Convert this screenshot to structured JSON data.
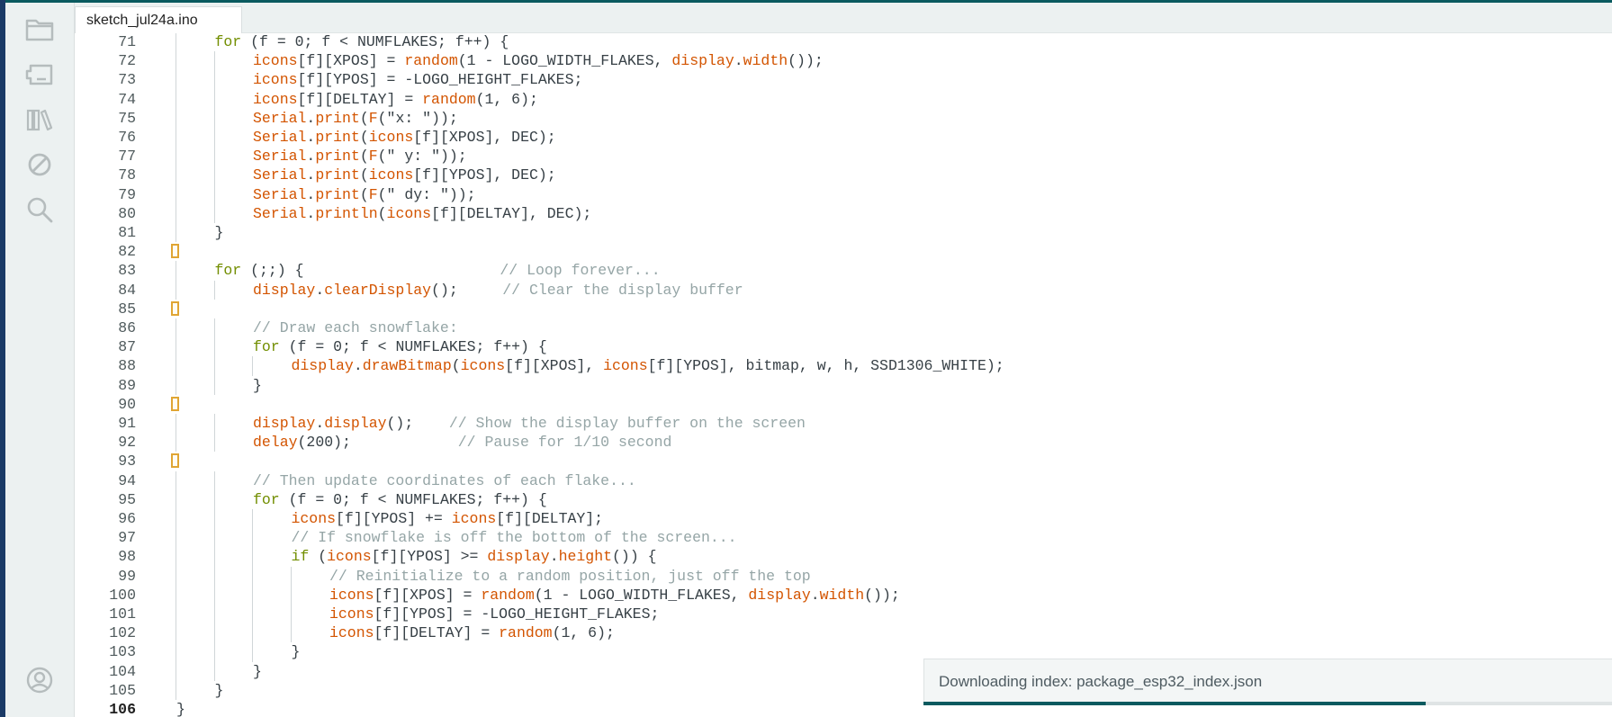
{
  "window": {
    "accent_color": "#0a5a5f"
  },
  "sidebar": {
    "items": [
      {
        "icon": "folder-icon",
        "label": "Sketchbook"
      },
      {
        "icon": "board-icon",
        "label": "Boards Manager"
      },
      {
        "icon": "library-icon",
        "label": "Library Manager"
      },
      {
        "icon": "debug-icon",
        "label": "Debug"
      },
      {
        "icon": "search-icon",
        "label": "Search"
      }
    ],
    "profile_icon": "profile-icon"
  },
  "tabs": [
    {
      "label": "sketch_jul24a.ino",
      "active": true
    }
  ],
  "editor": {
    "current_line": 106,
    "lines": [
      {
        "num": 71,
        "indent": 2,
        "tokens": [
          {
            "t": "for",
            "c": "keyword"
          },
          {
            "t": " (f = 0; f < NUMFLAKES; f++) {",
            "c": "plain"
          }
        ]
      },
      {
        "num": 72,
        "indent": 3,
        "tokens": [
          {
            "t": "icons",
            "c": "func"
          },
          {
            "t": "[f][XPOS] = ",
            "c": "plain"
          },
          {
            "t": "random",
            "c": "func"
          },
          {
            "t": "(1 - LOGO_WIDTH_FLAKES, ",
            "c": "plain"
          },
          {
            "t": "display",
            "c": "func"
          },
          {
            "t": ".",
            "c": "plain"
          },
          {
            "t": "width",
            "c": "func"
          },
          {
            "t": "());",
            "c": "plain"
          }
        ]
      },
      {
        "num": 73,
        "indent": 3,
        "tokens": [
          {
            "t": "icons",
            "c": "func"
          },
          {
            "t": "[f][YPOS] = -LOGO_HEIGHT_FLAKES;",
            "c": "plain"
          }
        ]
      },
      {
        "num": 74,
        "indent": 3,
        "tokens": [
          {
            "t": "icons",
            "c": "func"
          },
          {
            "t": "[f][DELTAY] = ",
            "c": "plain"
          },
          {
            "t": "random",
            "c": "func"
          },
          {
            "t": "(1, 6);",
            "c": "plain"
          }
        ]
      },
      {
        "num": 75,
        "indent": 3,
        "tokens": [
          {
            "t": "Serial",
            "c": "func"
          },
          {
            "t": ".",
            "c": "plain"
          },
          {
            "t": "print",
            "c": "func"
          },
          {
            "t": "(",
            "c": "plain"
          },
          {
            "t": "F",
            "c": "func"
          },
          {
            "t": "(\"x: \"));",
            "c": "plain"
          }
        ]
      },
      {
        "num": 76,
        "indent": 3,
        "tokens": [
          {
            "t": "Serial",
            "c": "func"
          },
          {
            "t": ".",
            "c": "plain"
          },
          {
            "t": "print",
            "c": "func"
          },
          {
            "t": "(",
            "c": "plain"
          },
          {
            "t": "icons",
            "c": "func"
          },
          {
            "t": "[f][XPOS], DEC);",
            "c": "plain"
          }
        ]
      },
      {
        "num": 77,
        "indent": 3,
        "tokens": [
          {
            "t": "Serial",
            "c": "func"
          },
          {
            "t": ".",
            "c": "plain"
          },
          {
            "t": "print",
            "c": "func"
          },
          {
            "t": "(",
            "c": "plain"
          },
          {
            "t": "F",
            "c": "func"
          },
          {
            "t": "(\" y: \"));",
            "c": "plain"
          }
        ]
      },
      {
        "num": 78,
        "indent": 3,
        "tokens": [
          {
            "t": "Serial",
            "c": "func"
          },
          {
            "t": ".",
            "c": "plain"
          },
          {
            "t": "print",
            "c": "func"
          },
          {
            "t": "(",
            "c": "plain"
          },
          {
            "t": "icons",
            "c": "func"
          },
          {
            "t": "[f][YPOS], DEC);",
            "c": "plain"
          }
        ]
      },
      {
        "num": 79,
        "indent": 3,
        "tokens": [
          {
            "t": "Serial",
            "c": "func"
          },
          {
            "t": ".",
            "c": "plain"
          },
          {
            "t": "print",
            "c": "func"
          },
          {
            "t": "(",
            "c": "plain"
          },
          {
            "t": "F",
            "c": "func"
          },
          {
            "t": "(\" dy: \"));",
            "c": "plain"
          }
        ]
      },
      {
        "num": 80,
        "indent": 3,
        "tokens": [
          {
            "t": "Serial",
            "c": "func"
          },
          {
            "t": ".",
            "c": "plain"
          },
          {
            "t": "println",
            "c": "func"
          },
          {
            "t": "(",
            "c": "plain"
          },
          {
            "t": "icons",
            "c": "func"
          },
          {
            "t": "[f][DELTAY], DEC);",
            "c": "plain"
          }
        ]
      },
      {
        "num": 81,
        "indent": 2,
        "tokens": [
          {
            "t": "}",
            "c": "plain"
          }
        ]
      },
      {
        "num": 82,
        "indent": 1,
        "marker": true,
        "tokens": []
      },
      {
        "num": 83,
        "indent": 2,
        "tokens": [
          {
            "t": "for",
            "c": "keyword"
          },
          {
            "t": " (;;) {                      ",
            "c": "plain"
          },
          {
            "t": "// Loop forever...",
            "c": "comment"
          }
        ]
      },
      {
        "num": 84,
        "indent": 3,
        "tokens": [
          {
            "t": "display",
            "c": "func"
          },
          {
            "t": ".",
            "c": "plain"
          },
          {
            "t": "clearDisplay",
            "c": "func"
          },
          {
            "t": "();     ",
            "c": "plain"
          },
          {
            "t": "// Clear the display buffer",
            "c": "comment"
          }
        ]
      },
      {
        "num": 85,
        "indent": 1,
        "marker": true,
        "tokens": []
      },
      {
        "num": 86,
        "indent": 3,
        "tokens": [
          {
            "t": "// Draw each snowflake:",
            "c": "comment"
          }
        ]
      },
      {
        "num": 87,
        "indent": 3,
        "tokens": [
          {
            "t": "for",
            "c": "keyword"
          },
          {
            "t": " (f = 0; f < NUMFLAKES; f++) {",
            "c": "plain"
          }
        ]
      },
      {
        "num": 88,
        "indent": 4,
        "tokens": [
          {
            "t": "display",
            "c": "func"
          },
          {
            "t": ".",
            "c": "plain"
          },
          {
            "t": "drawBitmap",
            "c": "func"
          },
          {
            "t": "(",
            "c": "plain"
          },
          {
            "t": "icons",
            "c": "func"
          },
          {
            "t": "[f][XPOS], ",
            "c": "plain"
          },
          {
            "t": "icons",
            "c": "func"
          },
          {
            "t": "[f][YPOS], bitmap, w, h, SSD1306_WHITE);",
            "c": "plain"
          }
        ]
      },
      {
        "num": 89,
        "indent": 3,
        "tokens": [
          {
            "t": "}",
            "c": "plain"
          }
        ]
      },
      {
        "num": 90,
        "indent": 1,
        "marker": true,
        "tokens": []
      },
      {
        "num": 91,
        "indent": 3,
        "tokens": [
          {
            "t": "display",
            "c": "func"
          },
          {
            "t": ".",
            "c": "plain"
          },
          {
            "t": "display",
            "c": "func"
          },
          {
            "t": "();    ",
            "c": "plain"
          },
          {
            "t": "// Show the display buffer on the screen",
            "c": "comment"
          }
        ]
      },
      {
        "num": 92,
        "indent": 3,
        "tokens": [
          {
            "t": "delay",
            "c": "func"
          },
          {
            "t": "(200);            ",
            "c": "plain"
          },
          {
            "t": "// Pause for 1/10 second",
            "c": "comment"
          }
        ]
      },
      {
        "num": 93,
        "indent": 1,
        "marker": true,
        "tokens": []
      },
      {
        "num": 94,
        "indent": 3,
        "tokens": [
          {
            "t": "// Then update coordinates of each flake...",
            "c": "comment"
          }
        ]
      },
      {
        "num": 95,
        "indent": 3,
        "tokens": [
          {
            "t": "for",
            "c": "keyword"
          },
          {
            "t": " (f = 0; f < NUMFLAKES; f++) {",
            "c": "plain"
          }
        ]
      },
      {
        "num": 96,
        "indent": 4,
        "tokens": [
          {
            "t": "icons",
            "c": "func"
          },
          {
            "t": "[f][YPOS] += ",
            "c": "plain"
          },
          {
            "t": "icons",
            "c": "func"
          },
          {
            "t": "[f][DELTAY];",
            "c": "plain"
          }
        ]
      },
      {
        "num": 97,
        "indent": 4,
        "tokens": [
          {
            "t": "// If snowflake is off the bottom of the screen...",
            "c": "comment"
          }
        ]
      },
      {
        "num": 98,
        "indent": 4,
        "tokens": [
          {
            "t": "if",
            "c": "keyword"
          },
          {
            "t": " (",
            "c": "plain"
          },
          {
            "t": "icons",
            "c": "func"
          },
          {
            "t": "[f][YPOS] >= ",
            "c": "plain"
          },
          {
            "t": "display",
            "c": "func"
          },
          {
            "t": ".",
            "c": "plain"
          },
          {
            "t": "height",
            "c": "func"
          },
          {
            "t": "()) {",
            "c": "plain"
          }
        ]
      },
      {
        "num": 99,
        "indent": 5,
        "tokens": [
          {
            "t": "// Reinitialize to a random position, just off the top",
            "c": "comment"
          }
        ]
      },
      {
        "num": 100,
        "indent": 5,
        "tokens": [
          {
            "t": "icons",
            "c": "func"
          },
          {
            "t": "[f][XPOS] = ",
            "c": "plain"
          },
          {
            "t": "random",
            "c": "func"
          },
          {
            "t": "(1 - LOGO_WIDTH_FLAKES, ",
            "c": "plain"
          },
          {
            "t": "display",
            "c": "func"
          },
          {
            "t": ".",
            "c": "plain"
          },
          {
            "t": "width",
            "c": "func"
          },
          {
            "t": "());",
            "c": "plain"
          }
        ]
      },
      {
        "num": 101,
        "indent": 5,
        "tokens": [
          {
            "t": "icons",
            "c": "func"
          },
          {
            "t": "[f][YPOS] = -LOGO_HEIGHT_FLAKES;",
            "c": "plain"
          }
        ]
      },
      {
        "num": 102,
        "indent": 5,
        "tokens": [
          {
            "t": "icons",
            "c": "func"
          },
          {
            "t": "[f][DELTAY] = ",
            "c": "plain"
          },
          {
            "t": "random",
            "c": "func"
          },
          {
            "t": "(1, 6);",
            "c": "plain"
          }
        ]
      },
      {
        "num": 103,
        "indent": 4,
        "tokens": [
          {
            "t": "}",
            "c": "plain"
          }
        ]
      },
      {
        "num": 104,
        "indent": 3,
        "tokens": [
          {
            "t": "}",
            "c": "plain"
          }
        ]
      },
      {
        "num": 105,
        "indent": 2,
        "tokens": [
          {
            "t": "}",
            "c": "plain"
          }
        ]
      },
      {
        "num": 106,
        "indent": 1,
        "tokens": [
          {
            "t": "}",
            "c": "plain"
          }
        ]
      }
    ]
  },
  "notification": {
    "text": "Downloading index: package_esp32_index.json",
    "progress": 0.73
  },
  "colors": {
    "keyword": "#728e00",
    "function": "#d35400",
    "comment": "#95a5a6",
    "text": "#374046",
    "marker": "#e0a533"
  }
}
